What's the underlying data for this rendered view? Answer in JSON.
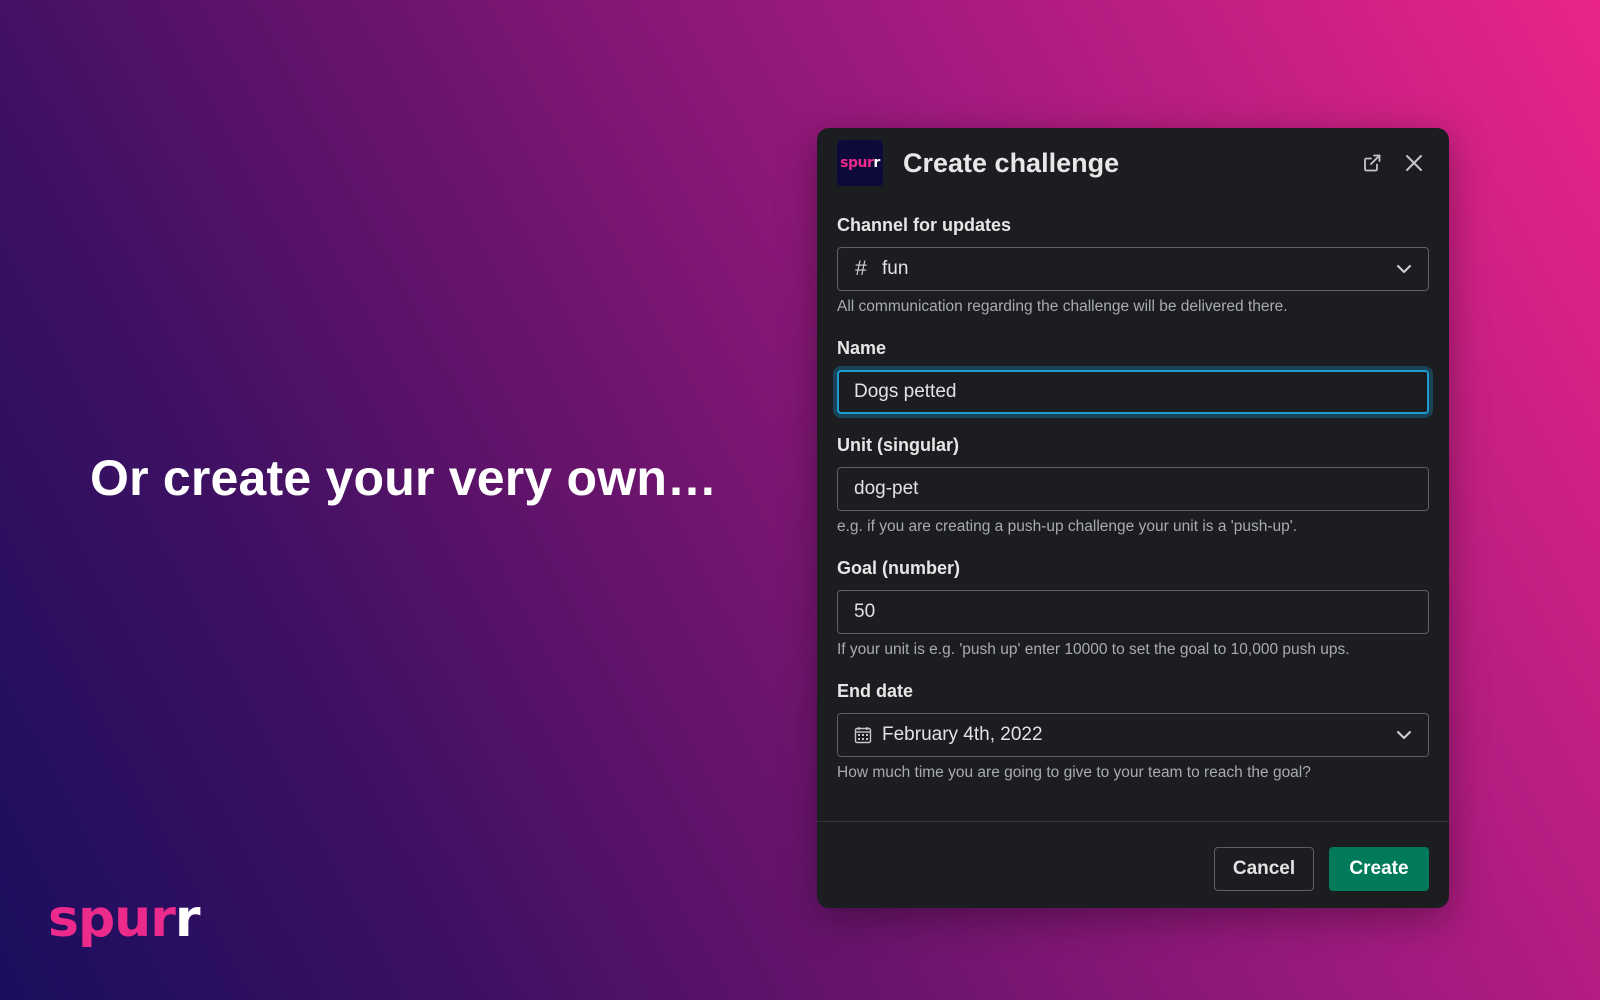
{
  "hero": {
    "tagline": "Or create your very own…"
  },
  "brand": {
    "part1": "spur",
    "part2": "r",
    "pink_color": "#ec2a8b"
  },
  "modal": {
    "title": "Create challenge",
    "logo": {
      "part1": "spur",
      "part2": "r"
    },
    "icons": {
      "open_external": "external-link-icon",
      "close": "close-icon"
    },
    "channel": {
      "label": "Channel for updates",
      "prefix": "#",
      "value": "fun",
      "hint": "All communication regarding the challenge will be delivered there."
    },
    "name": {
      "label": "Name",
      "value": "Dogs petted"
    },
    "unit": {
      "label": "Unit (singular)",
      "value": "dog-pet",
      "hint": "e.g. if you are creating a push-up challenge your unit is a 'push-up'."
    },
    "goal": {
      "label": "Goal (number)",
      "value": "50",
      "hint": "If your unit is e.g. 'push up' enter 10000 to set the goal to 10,000 push ups."
    },
    "end_date": {
      "label": "End date",
      "value": "February 4th, 2022",
      "hint": "How much time you are going to give to your team to reach the goal?"
    },
    "buttons": {
      "cancel": "Cancel",
      "create": "Create"
    },
    "colors": {
      "focus": "#1d9bd1",
      "primary": "#007a5a",
      "background": "#1b1d21"
    }
  }
}
